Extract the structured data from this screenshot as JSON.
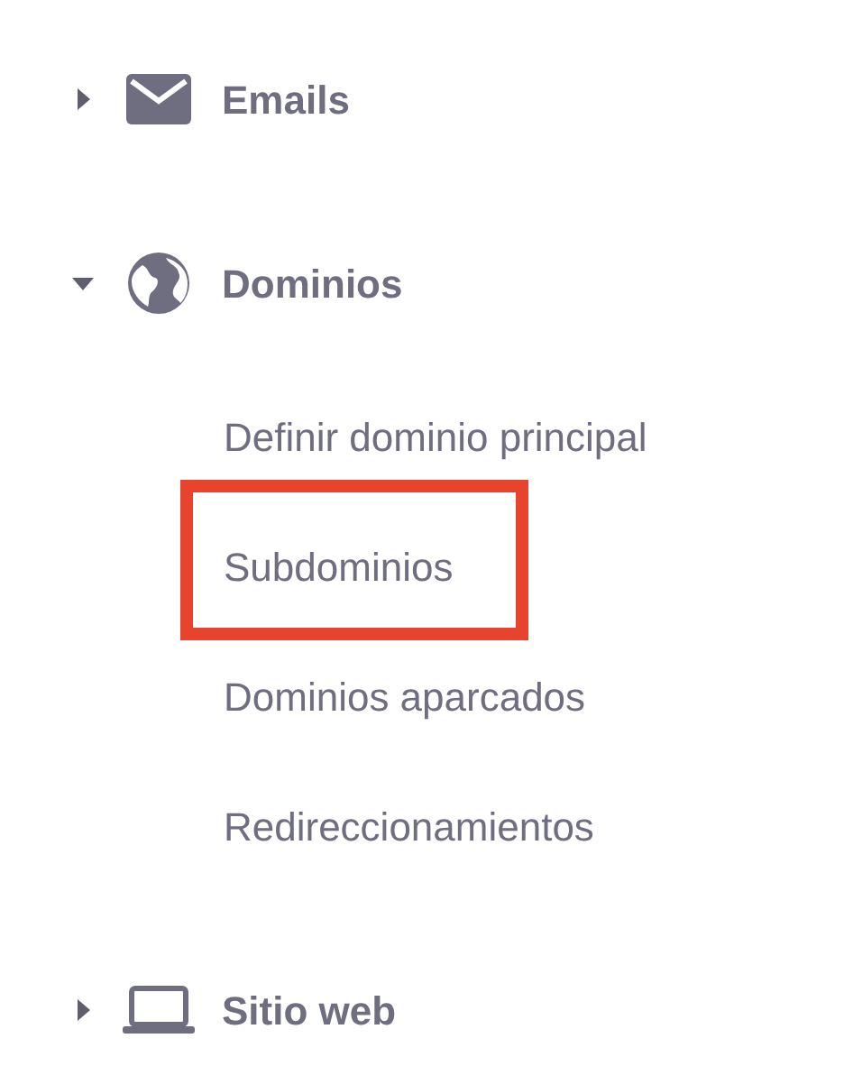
{
  "menu": [
    {
      "label": "Emails",
      "expanded": false
    },
    {
      "label": "Dominios",
      "expanded": true,
      "children": [
        {
          "label": "Definir dominio principal",
          "highlighted": false
        },
        {
          "label": "Subdominios",
          "highlighted": true
        },
        {
          "label": "Dominios aparcados",
          "highlighted": false
        },
        {
          "label": "Redireccionamientos",
          "highlighted": false
        }
      ]
    },
    {
      "label": "Sitio web",
      "expanded": false
    }
  ]
}
